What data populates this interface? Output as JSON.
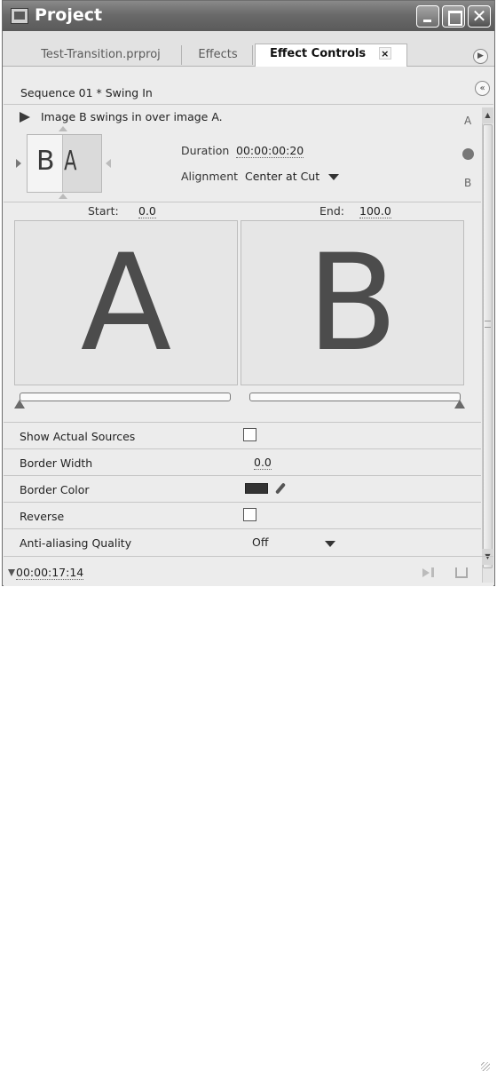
{
  "window": {
    "title": "Project"
  },
  "tabs": [
    {
      "label": "Test-Transition.prproj"
    },
    {
      "label": "Effects"
    },
    {
      "label": "Effect Controls",
      "close": "×"
    }
  ],
  "sequence": {
    "label": "Sequence 01 * Swing In"
  },
  "effect": {
    "description": "Image B swings in over image A.",
    "thumb_left_letter": "B",
    "thumb_right_letter": "A",
    "duration_label": "Duration",
    "duration_value": "00:00:00:20",
    "alignment_label": "Alignment",
    "alignment_value": "Center at Cut",
    "side_top": "A",
    "side_bottom": "B"
  },
  "range": {
    "start_label": "Start:",
    "start_value": "0.0",
    "end_label": "End:",
    "end_value": "100.0"
  },
  "previews": {
    "a_letter": "A",
    "b_letter": "B"
  },
  "properties": {
    "show_actual_sources": {
      "label": "Show Actual Sources",
      "checked": false
    },
    "border_width": {
      "label": "Border Width",
      "value": "0.0"
    },
    "border_color": {
      "label": "Border Color",
      "value": "#333333"
    },
    "reverse": {
      "label": "Reverse",
      "checked": false
    },
    "anti_aliasing": {
      "label": "Anti-aliasing Quality",
      "value": "Off"
    }
  },
  "footer": {
    "timecode": "00:00:17:14"
  }
}
